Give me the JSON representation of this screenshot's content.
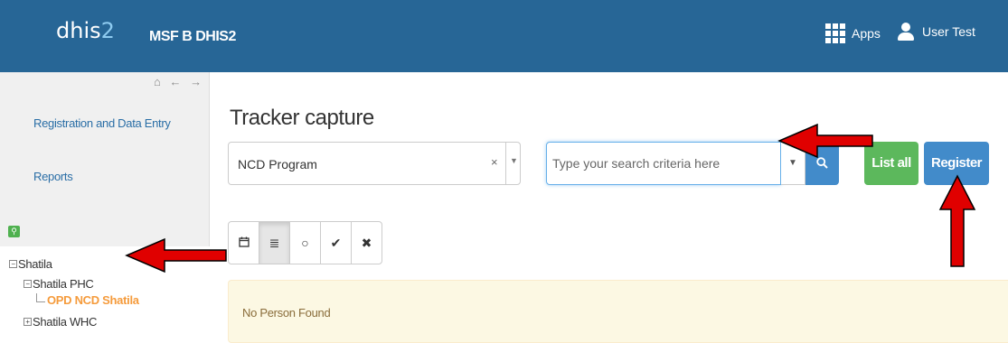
{
  "header": {
    "logo_text": "dhis",
    "logo_suffix": "2",
    "instance_title": "MSF B DHIS2",
    "apps_label": "Apps",
    "user_label": "User Test"
  },
  "sidebar": {
    "nav_icons": "⌂ ← →",
    "links": [
      {
        "label": "Registration and Data Entry"
      },
      {
        "label": "Reports"
      }
    ],
    "tree_search_icon": "search-icon",
    "tree": [
      {
        "label": "Shatila",
        "toggle": "−"
      },
      {
        "label": "Shatila PHC",
        "toggle": "−"
      },
      {
        "label": "OPD NCD Shatila",
        "selected": true
      },
      {
        "label": "Shatila WHC",
        "toggle": "+"
      }
    ]
  },
  "main": {
    "title": "Tracker capture",
    "program_select": {
      "value": "NCD Program",
      "clear": "×",
      "caret": "▼"
    },
    "search": {
      "placeholder": "Type your search criteria here",
      "caret": "▼"
    },
    "buttons": {
      "list_all": "List all",
      "register": "Register"
    },
    "view_buttons": [
      {
        "icon": "calendar-icon",
        "glyph": "📅"
      },
      {
        "icon": "list-icon",
        "glyph": "≣",
        "active": true
      },
      {
        "icon": "circle-icon",
        "glyph": "○"
      },
      {
        "icon": "check-icon",
        "glyph": "✔"
      },
      {
        "icon": "x-icon",
        "glyph": "✖"
      }
    ],
    "alert_text": "No Person Found"
  },
  "annotations": {
    "arrow_color": "#e00000"
  },
  "colors": {
    "header_bg": "#276696",
    "sidebar_bg": "#f0f0f0",
    "selected_unit": "#f59b3c",
    "btn_green": "#5cb85c",
    "btn_blue": "#428bca",
    "alert_bg": "#fcf8e3"
  }
}
